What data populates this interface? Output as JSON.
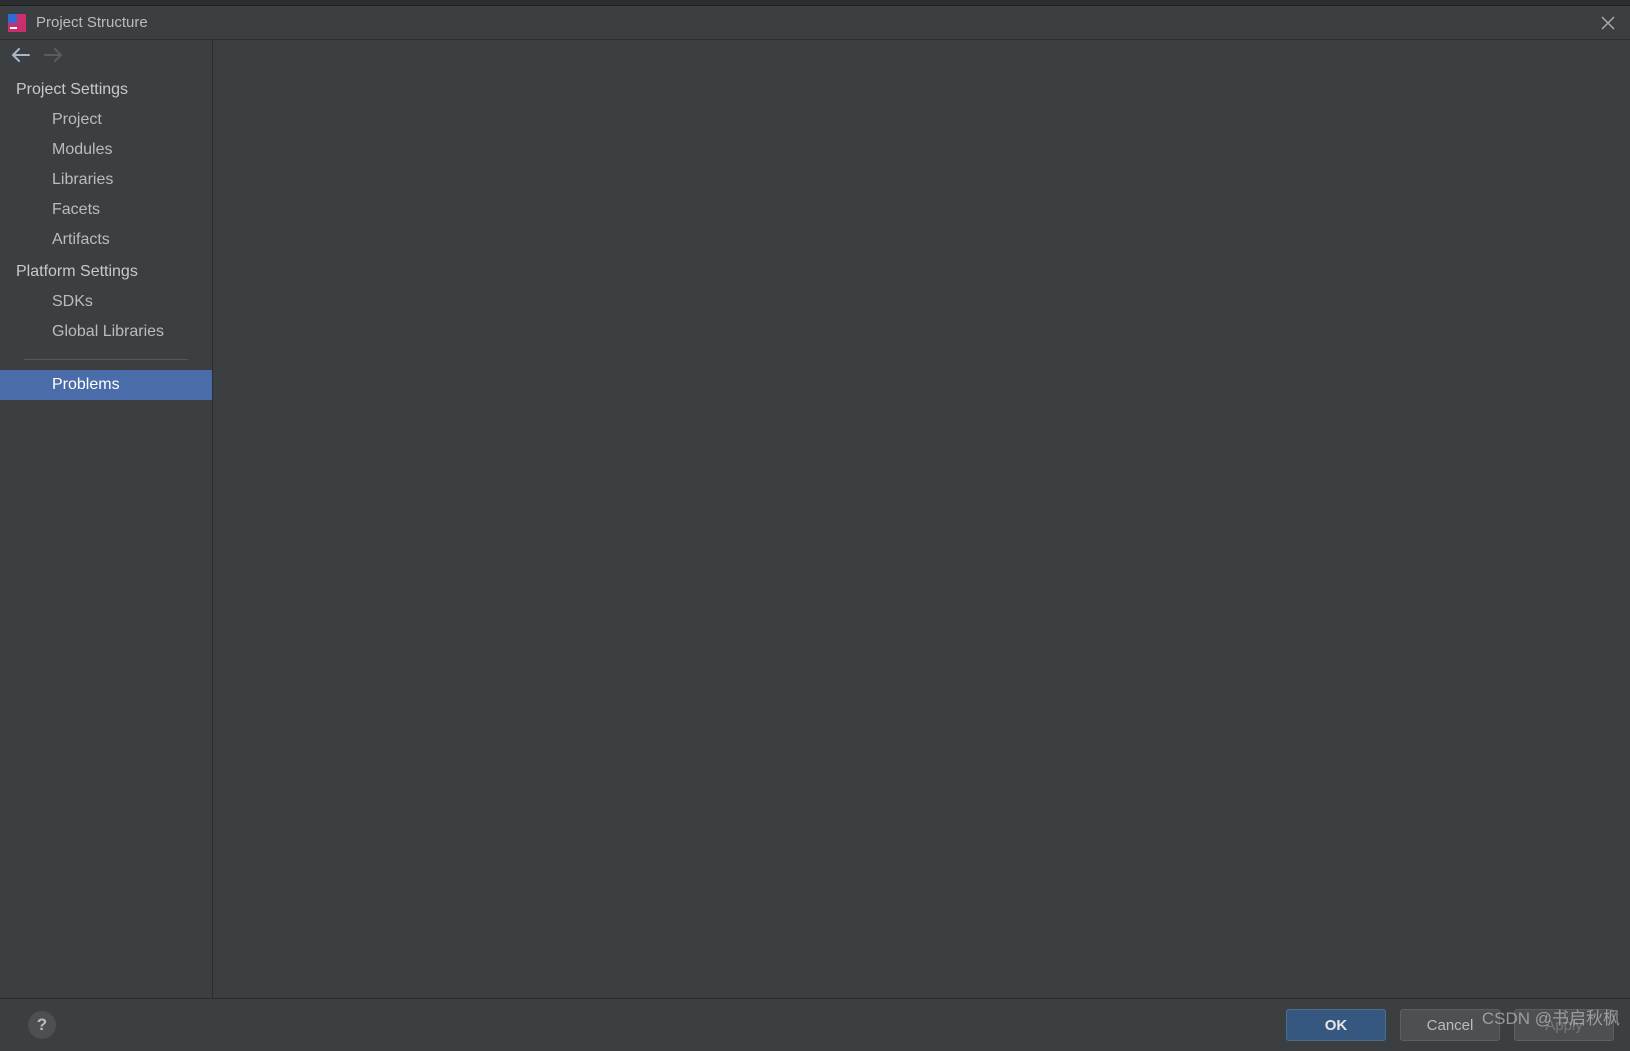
{
  "window": {
    "title": "Project Structure"
  },
  "sidebar": {
    "sections": {
      "project_settings": {
        "header": "Project Settings",
        "items": {
          "project": "Project",
          "modules": "Modules",
          "libraries": "Libraries",
          "facets": "Facets",
          "artifacts": "Artifacts"
        }
      },
      "platform_settings": {
        "header": "Platform Settings",
        "items": {
          "sdks": "SDKs",
          "global_libraries": "Global Libraries"
        }
      },
      "problems": {
        "label": "Problems"
      }
    }
  },
  "footer": {
    "help": "?",
    "ok": "OK",
    "cancel": "Cancel",
    "apply": "Apply"
  },
  "watermark": "CSDN @书启秋枫"
}
